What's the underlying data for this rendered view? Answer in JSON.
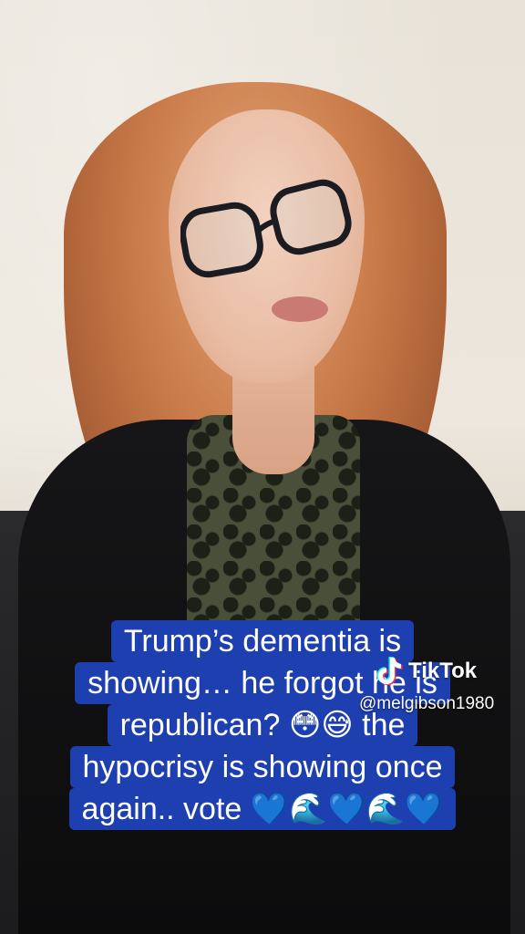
{
  "caption": {
    "lines": [
      "Trump’s dementia is",
      "showing… he forgot he is",
      "republican? 😳😅 the",
      "hypocrisy is showing once",
      "again.. vote 💙🌊💙🌊💙"
    ],
    "background_color": "#1e3fb0",
    "text_color": "#ffffff"
  },
  "watermark": {
    "brand": "TikTok",
    "handle": "@melgibson1980",
    "logo_icon": "tiktok-note-icon"
  }
}
